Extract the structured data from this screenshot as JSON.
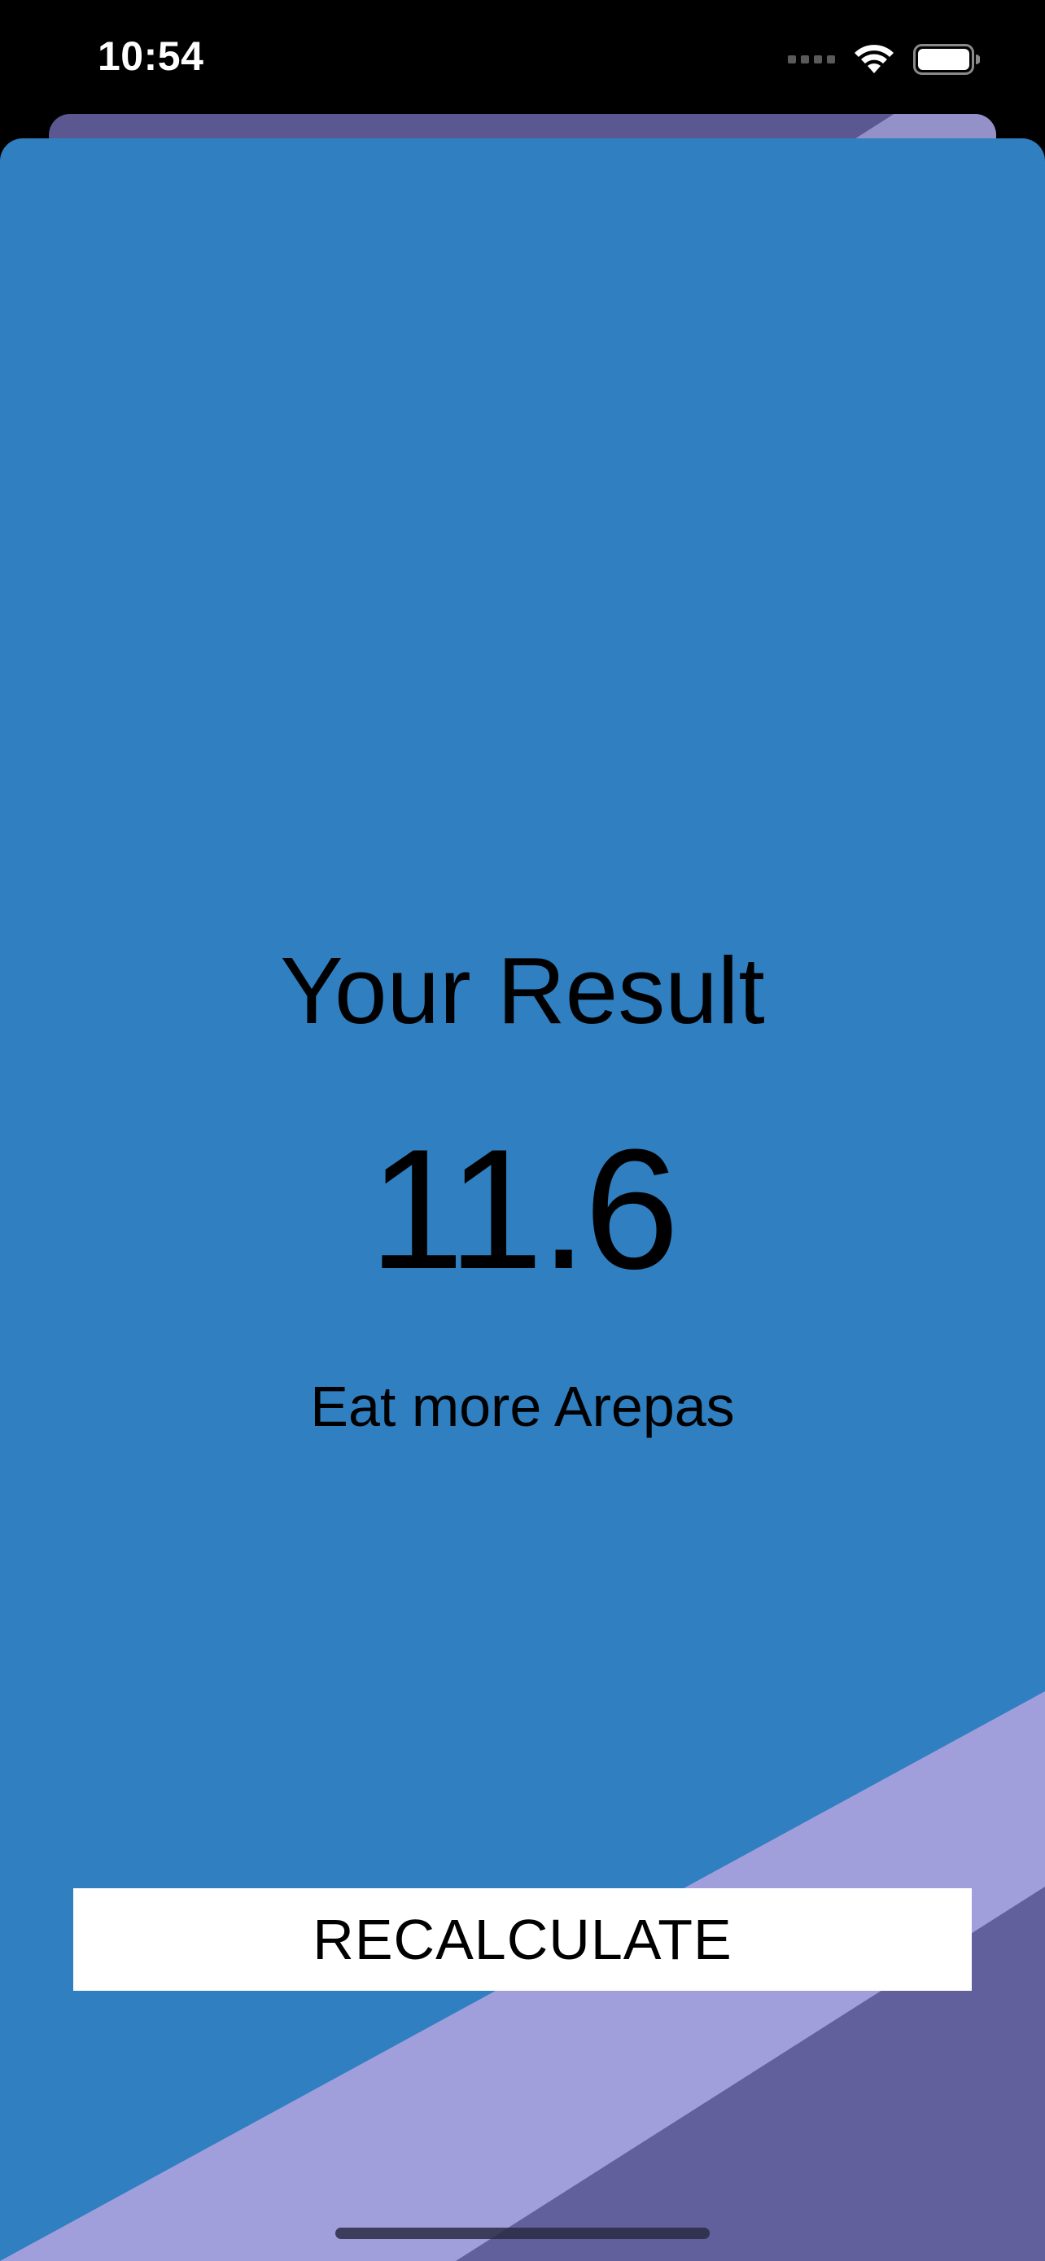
{
  "status_bar": {
    "time": "10:54",
    "icons": [
      "cellular-signal-icon",
      "wifi-icon",
      "battery-icon"
    ]
  },
  "result": {
    "title": "Your Result",
    "value": "11.6",
    "advice": "Eat more Arepas"
  },
  "actions": {
    "recalculate_label": "RECALCULATE"
  },
  "colors": {
    "background": "#2f7fc1",
    "stripe_light": "#a09fdc",
    "stripe_dark": "#62609c",
    "back_sheet": "#5b5891",
    "button_background": "#ffffff",
    "text": "#000000"
  }
}
